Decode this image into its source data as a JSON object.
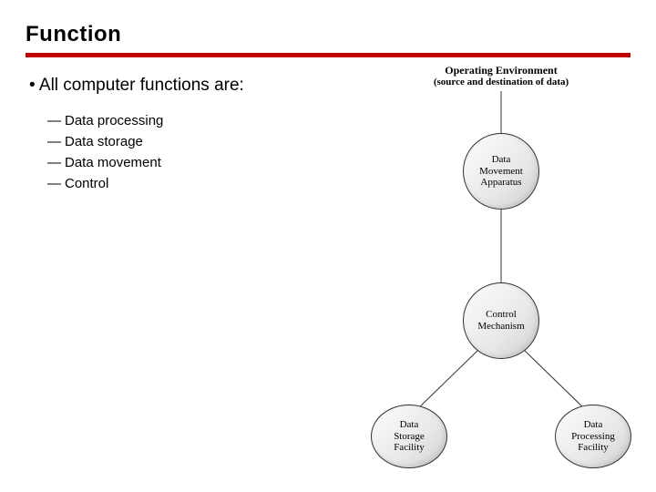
{
  "title": "Function",
  "lead": "All computer functions are:",
  "items": [
    "Data processing",
    "Data storage",
    "Data movement",
    "Control"
  ],
  "diagram": {
    "env_top": "Operating Environment",
    "env_sub": "(source and destination of data)",
    "node_movement": "Data\nMovement\nApparatus",
    "node_control": "Control\nMechanism",
    "node_storage": "Data\nStorage\nFacility",
    "node_processing": "Data\nProcessing\nFacility"
  }
}
